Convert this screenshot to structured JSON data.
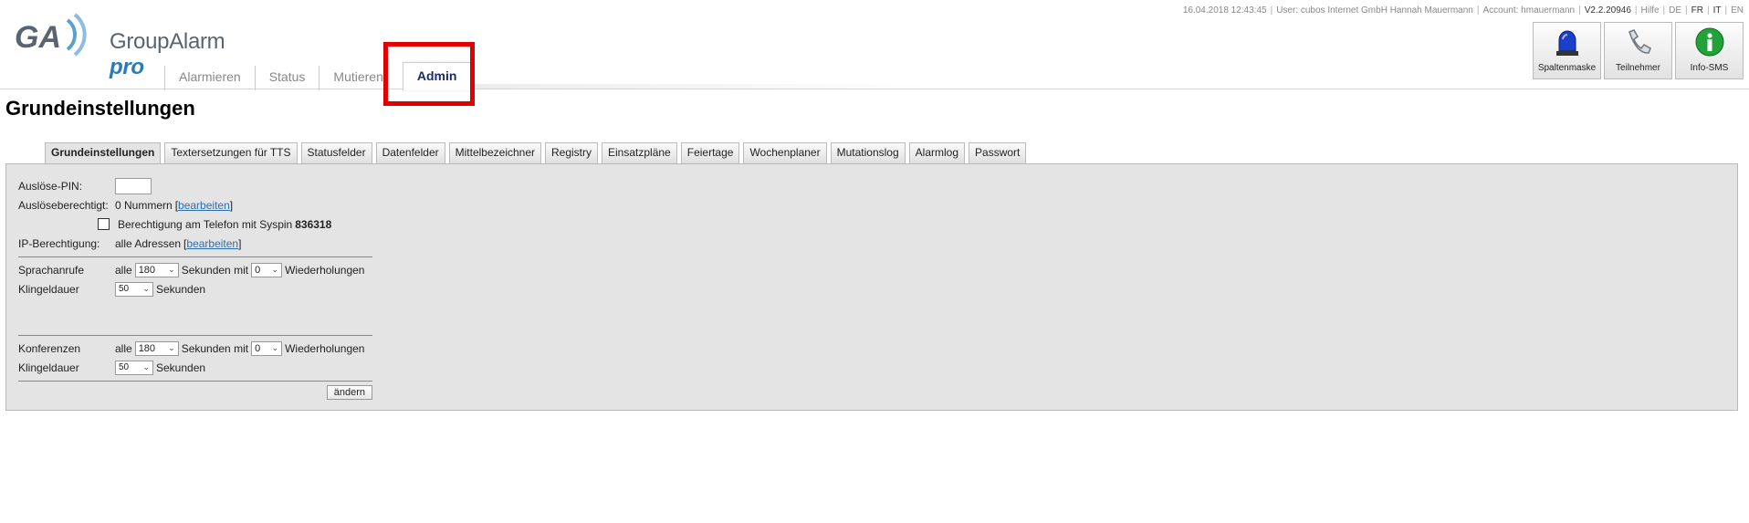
{
  "topinfo": {
    "datetime": "16.04.2018 12:43:45",
    "user": "User: cubos Internet GmbH Hannah Mauermann",
    "account": "Account: hmauermann",
    "version": "V2.2.20946",
    "help": "Hilfe",
    "languages": [
      "DE",
      "FR",
      "IT",
      "EN"
    ]
  },
  "logo": {
    "mark": "GA",
    "name": "GroupAlarm",
    "suffix": "pro"
  },
  "iconbuttons": [
    {
      "label": "Spaltenmaske",
      "icon": "siren-icon"
    },
    {
      "label": "Teilnehmer",
      "icon": "phone-icon"
    },
    {
      "label": "Info-SMS",
      "icon": "info-icon"
    }
  ],
  "nav": {
    "tabs": [
      "Alarmieren",
      "Status",
      "Mutieren",
      "Admin"
    ],
    "active": "Admin"
  },
  "page": {
    "title": "Grundeinstellungen"
  },
  "subtabs": [
    "Grundeinstellungen",
    "Textersetzungen für TTS",
    "Statusfelder",
    "Datenfelder",
    "Mittelbezeichner",
    "Registry",
    "Einsatzpläne",
    "Feiertage",
    "Wochenplaner",
    "Mutationslog",
    "Alarmlog",
    "Passwort"
  ],
  "form": {
    "pin_label": "Auslöse-PIN:",
    "pin_value": "",
    "berechtigt_label": "Auslöseberechtigt:",
    "berechtigt_value": "0 Nummern",
    "edit_link": "bearbeiten",
    "phone_perm_text": "Berechtigung am Telefon mit Syspin",
    "syspin": "836318",
    "ip_label": "IP-Berechtigung:",
    "ip_value": "alle Adressen",
    "sprach_label": "Sprachanrufe",
    "alle": "alle",
    "sekunden_mit": "Sekunden mit",
    "wiederholungen": "Wiederholungen",
    "sprach_interval": "180",
    "sprach_repeat": "0",
    "klingel_label": "Klingeldauer",
    "klingel1": "50",
    "sekunden": "Sekunden",
    "konf_label": "Konferenzen",
    "konf_interval": "180",
    "konf_repeat": "0",
    "klingel2": "50",
    "submit": "ändern"
  }
}
